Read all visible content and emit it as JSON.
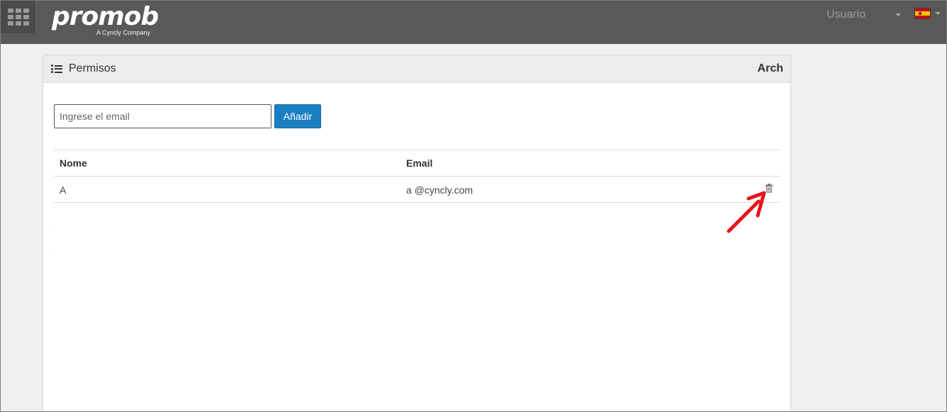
{
  "header": {
    "logo_text": "promob",
    "logo_subtitle": "A Cyncly Company",
    "user_label": "Usuario",
    "language_flag_icon": "spain-flag-icon",
    "apps_icon": "apps-grid-icon"
  },
  "panel": {
    "icon": "list-icon",
    "title": "Permisos",
    "right_label": "Arch"
  },
  "form": {
    "email_placeholder": "Ingrese el email",
    "email_value": "",
    "add_label": "Añadir"
  },
  "table": {
    "columns": [
      "Nome",
      "Email"
    ],
    "rows": [
      {
        "name": "A",
        "email": "a @cyncly.com",
        "action_icon": "trash-icon"
      }
    ]
  },
  "colors": {
    "topbar": "#595959",
    "primary_button": "#1a7fc1",
    "annotation_arrow": "#e8141b"
  }
}
